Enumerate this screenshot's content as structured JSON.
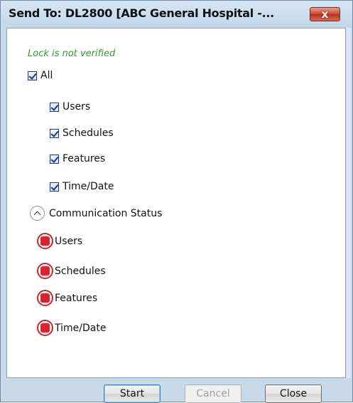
{
  "window": {
    "title": "Send To: DL2800 [ABC General Hospital -...",
    "close_glyph": "x"
  },
  "lock_status": "Lock is not verified",
  "checkboxes": {
    "all": {
      "label": "All",
      "checked": true
    },
    "items": [
      {
        "label": "Users",
        "checked": true
      },
      {
        "label": "Schedules",
        "checked": true
      },
      {
        "label": "Features",
        "checked": true
      },
      {
        "label": "Time/Date",
        "checked": true
      }
    ]
  },
  "communication_status": {
    "header": "Communication Status",
    "expanded": true,
    "items": [
      {
        "label": "Users",
        "state": "error",
        "icon": "red-stop-icon"
      },
      {
        "label": "Schedules",
        "state": "error",
        "icon": "red-stop-icon"
      },
      {
        "label": "Features",
        "state": "error",
        "icon": "red-stop-icon"
      },
      {
        "label": "Time/Date",
        "state": "error",
        "icon": "red-stop-icon"
      }
    ]
  },
  "buttons": {
    "start": "Start",
    "cancel": "Cancel",
    "close": "Close"
  },
  "colors": {
    "status_text": "#2f9a2f",
    "error_icon": "#e2202a",
    "frame": "#c8daea"
  }
}
